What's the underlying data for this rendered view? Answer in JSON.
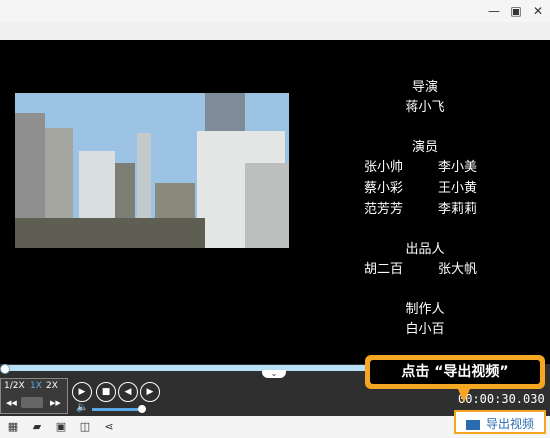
{
  "window": {
    "minimize_icon": "minimize-icon",
    "maximize_icon": "maximize-icon",
    "close_icon": "close-icon"
  },
  "credits": {
    "director_title": "导演",
    "director_name": "蒋小飞",
    "cast_title": "演员",
    "cast": [
      [
        "张小帅",
        "李小美"
      ],
      [
        "蔡小彩",
        "王小黄"
      ],
      [
        "范芳芳",
        "李莉莉"
      ]
    ],
    "producer_title": "出品人",
    "producers": [
      "胡二百",
      "张大帆"
    ],
    "maker_title": "制作人",
    "maker_name": "白小百"
  },
  "speed": {
    "options": [
      "1/2X",
      "1X",
      "2X"
    ],
    "selected": "1X"
  },
  "time_display": "00:00:30.030",
  "export_button": "导出视频",
  "callout_text": "点击 “导出视频”",
  "colors": {
    "accent": "#f5a623",
    "export_text": "#2b6cb0",
    "seek": "#b9dff7"
  }
}
